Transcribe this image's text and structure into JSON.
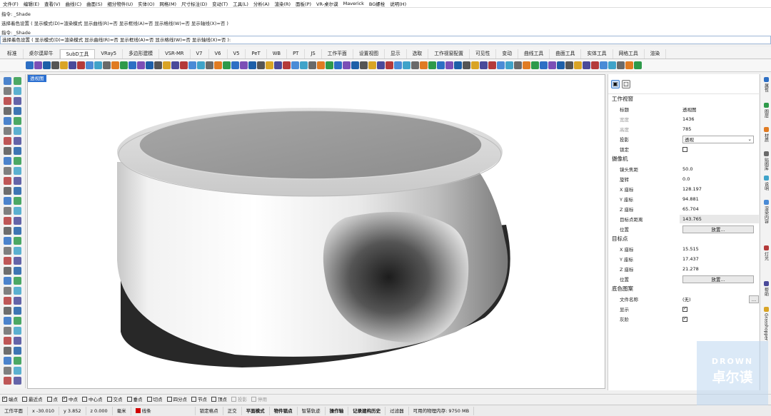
{
  "menu": [
    "文件(F)",
    "编辑(E)",
    "查看(V)",
    "曲线(C)",
    "曲面(S)",
    "细分物件(U)",
    "实体(O)",
    "网格(M)",
    "尺寸标注(D)",
    "变动(T)",
    "工具(L)",
    "分析(A)",
    "渲染(R)",
    "面板(P)",
    "VR-桌尔谟",
    "Maverick",
    "BG螺栓",
    "说明(H)"
  ],
  "command": {
    "lines": [
      "指令: _Shade",
      "选择着色设置 ( 显示模式(D)=渲染模式  显示曲线(R)=否  显示框线(A)=否  显示格线(W)=否  显示轴线(X)=否 )",
      "指令: _Shade"
    ],
    "prompt": "选择着色设置 ( 显示模式(D)=渲染模式  显示曲线(R)=否  显示框线(A)=否  显示格线(W)=否  显示轴线(X)=否 ):"
  },
  "tabs": [
    "标准",
    "桌尔谟犀牛",
    "SubD工具",
    "VRay5",
    "多边形建模",
    "VSR-MR",
    "V7",
    "V6",
    "V5",
    "PeT",
    "WB",
    "PT",
    "JS",
    "工作平面",
    "设置视图",
    "显示",
    "选取",
    "工作视窗配置",
    "可见性",
    "变动",
    "曲线工具",
    "曲面工具",
    "实体工具",
    "网格工具",
    "渲染"
  ],
  "active_tab": "SubD工具",
  "viewport": {
    "label": "透视图"
  },
  "properties": {
    "sections": {
      "viewport": "工作视窗",
      "camera": "摄像机",
      "target": "目标点",
      "wallpaper": "底色图案"
    },
    "viewport_rows": [
      {
        "k": "标题",
        "v": "透视图",
        "type": "text"
      },
      {
        "k": "宽度",
        "v": "1436",
        "type": "text",
        "dim": true
      },
      {
        "k": "高度",
        "v": "785",
        "type": "text",
        "dim": true
      },
      {
        "k": "投影",
        "v": "透视",
        "type": "select"
      },
      {
        "k": "锁定",
        "v": "",
        "type": "check",
        "checked": false
      }
    ],
    "camera_rows": [
      {
        "k": "镜头焦距",
        "v": "50.0",
        "type": "text"
      },
      {
        "k": "旋转",
        "v": "0.0",
        "type": "text"
      },
      {
        "k": "X 座标",
        "v": "128.197",
        "type": "text"
      },
      {
        "k": "Y 座标",
        "v": "94.881",
        "type": "text"
      },
      {
        "k": "Z 座标",
        "v": "65.704",
        "type": "text"
      },
      {
        "k": "目标点距离",
        "v": "143.765",
        "type": "text",
        "grey": true
      },
      {
        "k": "位置",
        "v": "放置...",
        "type": "button"
      }
    ],
    "target_rows": [
      {
        "k": "X 座标",
        "v": "15.515",
        "type": "text"
      },
      {
        "k": "Y 座标",
        "v": "17.437",
        "type": "text"
      },
      {
        "k": "Z 座标",
        "v": "21.278",
        "type": "text"
      },
      {
        "k": "位置",
        "v": "放置...",
        "type": "button"
      }
    ],
    "wallpaper_rows": [
      {
        "k": "文件名称",
        "v": "(无)",
        "type": "file"
      },
      {
        "k": "显示",
        "v": "",
        "type": "check",
        "checked": true
      },
      {
        "k": "灰阶",
        "v": "",
        "type": "check",
        "checked": true
      }
    ]
  },
  "right_tabs": [
    "属性",
    "图层",
    "材质",
    "贴图库",
    "说明",
    "渲染内容",
    "灯光",
    "帮助",
    "Grasshopper"
  ],
  "osnap": [
    {
      "label": "端点",
      "checked": true
    },
    {
      "label": "最近点",
      "checked": false
    },
    {
      "label": "点",
      "checked": false
    },
    {
      "label": "中点",
      "checked": true
    },
    {
      "label": "中心点",
      "checked": false
    },
    {
      "label": "交点",
      "checked": false
    },
    {
      "label": "垂点",
      "checked": false
    },
    {
      "label": "切点",
      "checked": false
    },
    {
      "label": "四分点",
      "checked": false
    },
    {
      "label": "节点",
      "checked": false
    },
    {
      "label": "顶点",
      "checked": false
    },
    {
      "label": "投影",
      "checked": false,
      "disabled": true
    },
    {
      "label": "停用",
      "checked": false,
      "disabled": true
    }
  ],
  "status": {
    "plane": "工作平面",
    "x": "x -30.010",
    "y": "y 3.852",
    "z": "z 0.000",
    "unit": "毫米",
    "layer": "线条",
    "items": [
      "锁定格点",
      "正交",
      "平面模式",
      "物件锁点",
      "智慧轨迹",
      "操作轴",
      "记录建构历史",
      "过滤器"
    ],
    "bold_items": [
      "平面模式",
      "物件锁点",
      "操作轴",
      "记录建构历史"
    ],
    "memory": "可用的物理内存: 9750 MB"
  },
  "watermark": {
    "line1": "DROWN",
    "line2": "卓尔谟"
  }
}
